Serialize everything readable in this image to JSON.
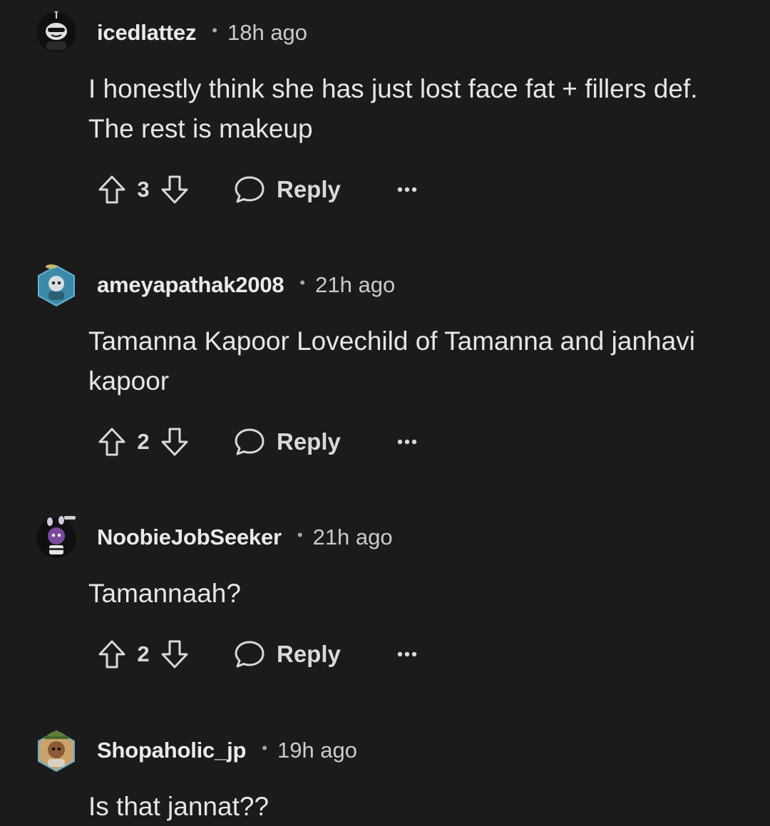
{
  "comments": [
    {
      "username": "icedlattez",
      "separator": "•",
      "time": "18h ago",
      "text": "I honestly think she has just lost face fat + fillers def. The rest is makeup",
      "score": "3",
      "reply_label": "Reply"
    },
    {
      "username": "ameyapathak2008",
      "separator": "•",
      "time": "21h ago",
      "text": "Tamanna Kapoor Lovechild of Tamanna and janhavi kapoor",
      "score": "2",
      "reply_label": "Reply"
    },
    {
      "username": "NoobieJobSeeker",
      "separator": "•",
      "time": "21h ago",
      "text": "Tamannaah?",
      "score": "2",
      "reply_label": "Reply"
    },
    {
      "username": "Shopaholic_jp",
      "separator": "•",
      "time": "19h ago",
      "text": "Is that jannat??"
    }
  ],
  "icons": {
    "upvote": "arrow-up-outline-icon",
    "downvote": "arrow-down-outline-icon",
    "reply": "speech-bubble-icon",
    "more": "ellipsis-icon"
  },
  "colors": {
    "background": "#1b1b1b",
    "text": "#d7dadc"
  }
}
